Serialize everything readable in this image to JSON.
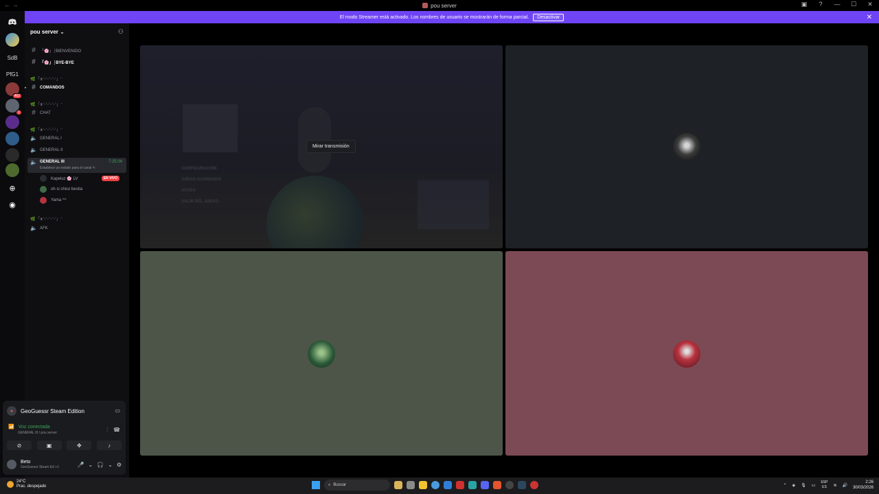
{
  "window": {
    "title": "pou server",
    "nav": "← →",
    "controls": [
      "▣",
      "?",
      "—",
      "☐",
      "✕"
    ]
  },
  "streamer_banner": {
    "text": "El modo Streamer está activado. Los nombres de usuario se mostrarán de forma parcial.",
    "button": "Desactivar",
    "close": "✕",
    "color": "#6e44f5"
  },
  "guilds": {
    "items": [
      "SdB",
      "PfG1"
    ],
    "badges": [
      "462",
      "1"
    ]
  },
  "server": {
    "name": "pou server",
    "channels": {
      "bienvenido": "「🌸」┆BIENVENIDO",
      "bye": "「🌸」┆BYE-BYE",
      "category1": "🌿「ᴥ'ᵕ'ᵕ'ᵕ'ᵕ'」ᵔ",
      "comandos": "COMANDOS",
      "category2": "🌿「ᴥ'ᵕ'ᵕ'ᵕ'ᵕ'」ᵔ",
      "chat": "CHAT",
      "category3": "🌿「ᴥ'ᵕ'ᵕ'ᵕ'ᵕ'」ᵔ",
      "general1": "GENERAL I",
      "general2": "GENERAL II",
      "general3": "GENERAL III",
      "general3_time": "7:25:04",
      "general3_status": "Establece un estado para el canal ✎",
      "category4": "🌿「ᴥ'ᵕ'ᵕ'ᵕ'ᵕ'」ᵔ",
      "afk": "AFK"
    },
    "voice_users": [
      {
        "name": "Kapeluz 🌸 LV",
        "live": "EN VIVO",
        "color": "#2a2d33"
      },
      {
        "name": "oh si chico bestia",
        "live": "",
        "color": "#3f6b47"
      },
      {
        "name": "Yama ^^",
        "live": "",
        "color": "#b8323f"
      }
    ]
  },
  "panel": {
    "activity": "GeoGuessr Steam Edition",
    "voice_status": "Voz conectada",
    "voice_sub": "GENERAL III / pou server",
    "user_name": "Beto",
    "user_status": "GeoGuessr Steam Ed +1"
  },
  "stage": {
    "watch_label": "Mirar transmisión",
    "menu_lines": [
      "CONFIGURACIÓN",
      "JUEGO GUARDADO",
      "AYUDA",
      "SALIR DEL JUEGO"
    ]
  },
  "taskbar": {
    "temp": "24°C",
    "weather": "Prac. despejado",
    "search": "Buscar",
    "lang1": "ESP",
    "lang2": "ES",
    "time": "2:26",
    "date": "30/03/2026"
  }
}
